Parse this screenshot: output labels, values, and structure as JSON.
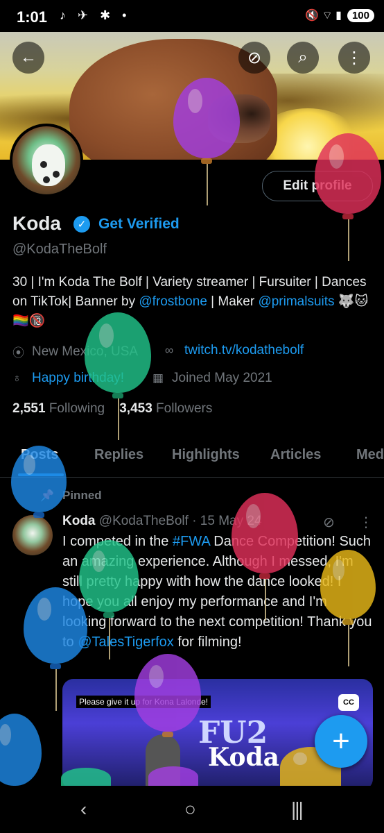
{
  "status_bar": {
    "time": "1:01",
    "left_icons": "♪ ✈ ✱ •",
    "right_icons": "🔇 ⌔ ▮",
    "battery": "100"
  },
  "top_buttons": {
    "back": "←",
    "grok": "⊘",
    "search": "⌕",
    "more": "⋮"
  },
  "profile": {
    "edit_label": "Edit profile",
    "name": "Koda",
    "verified_mark": "✓",
    "get_verified": "Get Verified",
    "handle": "@KodaTheBolf",
    "bio_text1": "30 | I'm Koda The Bolf | Variety streamer | Fursuiter | Dances on TikTok| Banner by ",
    "bio_link1": "@frostbone",
    "bio_text2": " | Maker ",
    "bio_link2": "@primalsuits",
    "bio_emoji": " 🐺🐱🏳️‍🌈🔞",
    "location": "New Mexico, USA",
    "website": "twitch.tv/kodathebolf",
    "birthday": "Happy birthday!",
    "joined": "Joined May 2021",
    "following_count": "2,551",
    "following_label": "Following",
    "followers_count": "3,453",
    "followers_label": "Followers"
  },
  "tabs": [
    "Posts",
    "Replies",
    "Highlights",
    "Articles",
    "Media"
  ],
  "pinned_label": "Pinned",
  "tweet": {
    "author": "Koda",
    "handle_date": "@KodaTheBolf · 15 May 24",
    "text1": "I competed in the ",
    "hashtag": "#FWA",
    "text2": " Dance Competition! Such an amazing experience. Although I messed, I'm still pretty happy with how the dance looked! I hope you all enjoy my performance and I'm looking forward to the next competition! Thank you to ",
    "mention": "@TalesTigerfox",
    "text3": " for filming!",
    "media_caption": "Please give it up for Kona Lalonde!",
    "cc": "CC",
    "media_logo": "FU2",
    "media_logo2": "Koda"
  },
  "fab": "+",
  "nav": {
    "back": "‹",
    "home": "○",
    "recents": "|||"
  },
  "colors": {
    "accent": "#1d9bf0",
    "background": "#000000",
    "text": "#e7e9ea",
    "muted": "#71767b"
  }
}
